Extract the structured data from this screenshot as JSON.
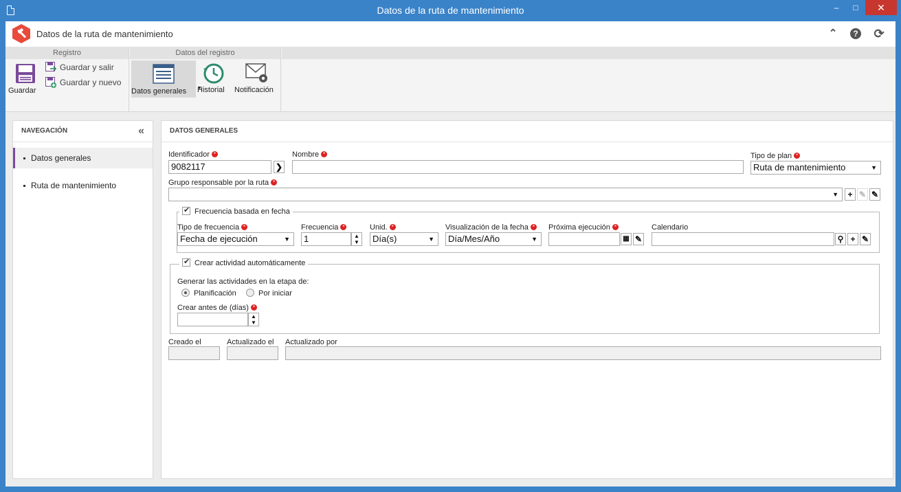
{
  "window": {
    "title": "Datos de la ruta de mantenimiento"
  },
  "app": {
    "title": "Datos de la ruta de mantenimiento"
  },
  "ribbon": {
    "group1_label": "Registro",
    "group2_label": "Datos del registro",
    "save_label": "Guardar",
    "save_exit_label": "Guardar y salir",
    "save_new_label": "Guardar y nuevo",
    "general_data_label": "Datos generales",
    "history_label": "Historial",
    "notification_label": "Notificación"
  },
  "nav": {
    "title": "NAVEGACIÓN",
    "items": [
      {
        "label": "Datos generales",
        "active": true
      },
      {
        "label": "Ruta de mantenimiento",
        "active": false
      }
    ]
  },
  "main": {
    "title": "DATOS GENERALES",
    "identifier_label": "Identificador",
    "identifier_value": "9082117",
    "name_label": "Nombre",
    "name_value": "",
    "plan_type_label": "Tipo de plan",
    "plan_type_value": "Ruta de mantenimiento",
    "group_label": "Grupo responsable por la ruta",
    "group_value": "",
    "frequency_section": {
      "legend": "Frecuencia basada en fecha",
      "checked": true,
      "freq_type_label": "Tipo de frecuencia",
      "freq_type_value": "Fecha de ejecución",
      "freq_label": "Frecuencia",
      "freq_value": "1",
      "unit_label": "Unid.",
      "unit_value": "Día(s)",
      "date_display_label": "Visualización de la fecha",
      "date_display_value": "Día/Mes/Año",
      "next_exec_label": "Próxima ejecución",
      "next_exec_value": "",
      "calendar_label": "Calendario",
      "calendar_value": ""
    },
    "activity_section": {
      "legend": "Crear actividad automáticamente",
      "checked": true,
      "stage_label": "Generar las actividades en la etapa de:",
      "option_planning": "Planificación",
      "option_pending": "Por iniciar",
      "selected_option": "Planificación",
      "days_before_label": "Crear antes de (días)",
      "days_before_value": ""
    },
    "created_label": "Creado el",
    "updated_label": "Actualizado el",
    "updated_by_label": "Actualizado por"
  },
  "colors": {
    "titlebar": "#3a83c9",
    "close": "#c7372f",
    "accent": "#7a4a9a",
    "logo": "#e84a3c"
  }
}
